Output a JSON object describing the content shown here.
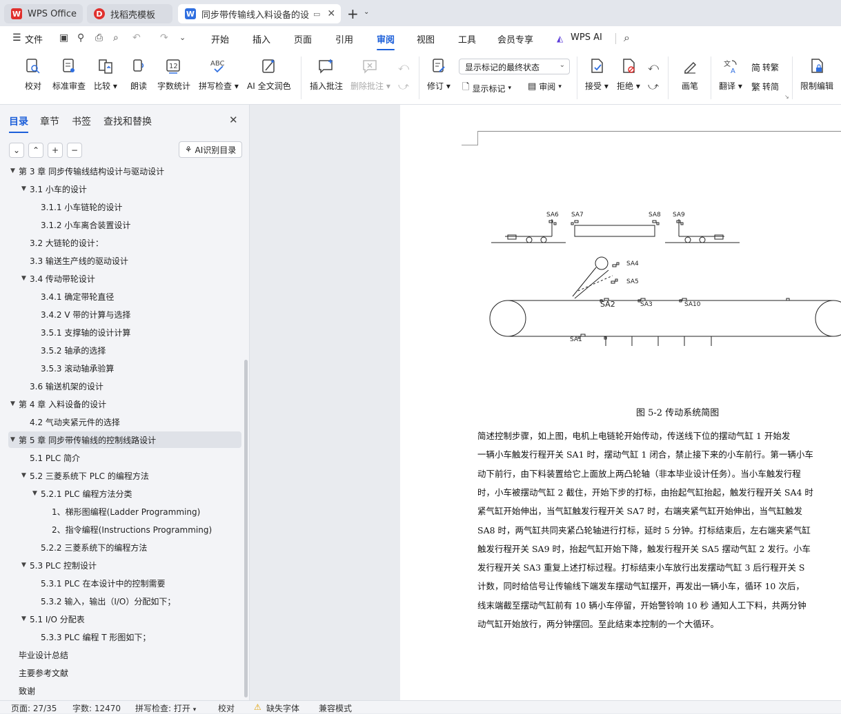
{
  "tabs": [
    {
      "label": "WPS Office",
      "icon": "wps-logo-icon"
    },
    {
      "label": "找稻壳模板",
      "icon": "docer-icon"
    },
    {
      "label": "同步带传输线入料设备的设计",
      "icon": "word-doc-icon"
    }
  ],
  "menu": {
    "file_label": "文件",
    "items": [
      "开始",
      "插入",
      "页面",
      "引用",
      "审阅",
      "视图",
      "工具",
      "会员专享",
      "WPS AI"
    ],
    "active": "审阅"
  },
  "ribbon": {
    "proofread": "校对",
    "standard_review": "标准审查",
    "compare": "比较",
    "read_aloud": "朗读",
    "word_count": "字数统计",
    "spell_check": "拼写检查",
    "ai_polish": "AI 全文润色",
    "insert_comment": "插入批注",
    "delete_comment": "删除批注",
    "track_changes": "修订",
    "display_mode": "显示标记的最终状态",
    "show_markup": "显示标记",
    "reviewing": "审阅",
    "accept": "接受",
    "reject": "拒绝",
    "pen": "画笔",
    "translate": "翻译",
    "to_traditional": "转繁",
    "to_simplified": "转简",
    "restrict_edit": "限制编辑"
  },
  "nav": {
    "tabs": [
      "目录",
      "章节",
      "书签",
      "查找和替换"
    ],
    "ai_toc_label": "AI识别目录",
    "items": [
      {
        "text": "第 3 章 同步传输线结构设计与驱动设计",
        "level": 1,
        "arrow": "down"
      },
      {
        "text": "3.1 小车的设计",
        "level": 2,
        "arrow": "down"
      },
      {
        "text": "3.1.1 小车链轮的设计",
        "level": 3,
        "arrow": ""
      },
      {
        "text": "3.1.2 小车离合装置设计",
        "level": 3,
        "arrow": ""
      },
      {
        "text": "3.2 大链轮的设计：",
        "level": 2,
        "arrow": ""
      },
      {
        "text": "3.3    输送生产线的驱动设计",
        "level": 2,
        "arrow": ""
      },
      {
        "text": "3.4  传动带轮设计",
        "level": 2,
        "arrow": "down"
      },
      {
        "text": "3.4.1 确定带轮直径",
        "level": 3,
        "arrow": ""
      },
      {
        "text": "3.4.2    V 带的计算与选择",
        "level": 3,
        "arrow": ""
      },
      {
        "text": "3.5.1    支撑轴的设计计算",
        "level": 3,
        "arrow": ""
      },
      {
        "text": "3.5.2 轴承的选择",
        "level": 3,
        "arrow": ""
      },
      {
        "text": "3.5.3 滚动轴承验算",
        "level": 3,
        "arrow": ""
      },
      {
        "text": "3.6 输送机架的设计",
        "level": 2,
        "arrow": ""
      },
      {
        "text": "第 4 章    入料设备的设计",
        "level": 1,
        "arrow": "down"
      },
      {
        "text": "4.2 气动夹紧元件的选择",
        "level": 2,
        "arrow": ""
      },
      {
        "text": "第 5 章    同步带传输线的控制线路设计",
        "level": 1,
        "arrow": "down",
        "selected": true
      },
      {
        "text": "5.1 PLC 简介",
        "level": 2,
        "arrow": ""
      },
      {
        "text": "5.2 三菱系统下 PLC 的编程方法",
        "level": 2,
        "arrow": "down"
      },
      {
        "text": "5.2.1 PLC 编程方法分类",
        "level": 3,
        "arrow": "down"
      },
      {
        "text": "1、梯形图编程(Ladder Programming)",
        "level": 4,
        "arrow": ""
      },
      {
        "text": "2、指令编程(Instructions Programming)",
        "level": 4,
        "arrow": ""
      },
      {
        "text": "5.2.2  三菱系统下的编程方法",
        "level": 3,
        "arrow": ""
      },
      {
        "text": "5.3 PLC 控制设计",
        "level": 2,
        "arrow": "down"
      },
      {
        "text": "5.3.1    PLC 在本设计中的控制需要",
        "level": 3,
        "arrow": ""
      },
      {
        "text": "5.3.2 输入，输出（I/O）分配如下；",
        "level": 3,
        "arrow": ""
      },
      {
        "text": "5.1    I/O 分配表",
        "level": 2,
        "arrow": "down"
      },
      {
        "text": "5.3.3 PLC 编程 T 形图如下；",
        "level": 3,
        "arrow": ""
      },
      {
        "text": "毕业设计总结",
        "level": 1,
        "arrow": ""
      },
      {
        "text": "主要参考文献",
        "level": 1,
        "arrow": ""
      },
      {
        "text": "致谢",
        "level": 1,
        "arrow": ""
      }
    ]
  },
  "document": {
    "diagram_labels": {
      "sa1": "SA1",
      "sa2": "SA2",
      "sa3": "SA3",
      "sa4": "SA4",
      "sa5": "SA5",
      "sa6": "SA6",
      "sa7": "SA7",
      "sa8": "SA8",
      "sa9": "SA9",
      "sa10": "SA10"
    },
    "figure_caption": "图 5-2 传动系统简图",
    "paragraph_lines": [
      "    简述控制步骤，如上图，电机上电链轮开始传动，传送线下位的摆动气缸 1 开始发",
      "一辆小车触发行程开关 SA1 时，摆动气缸 1 闭合，禁止接下来的小车前行。第一辆小车",
      "动下前行，由下料装置给它上面放上两凸轮轴（非本毕业设计任务）。当小车触发行程",
      "时，小车被摆动气缸 2 截住，开始下步的打标，由抬起气缸抬起，触发行程开关 SA4 时",
      "紧气缸开始伸出，当气缸触发行程开关 SA7 时，右端夹紧气缸开始伸出，当气缸触发",
      "SA8 时，两气缸共同夹紧凸轮轴进行打标，延时 5 分钟。打标结束后，左右端夹紧气缸",
      "触发行程开关 SA9 时，抬起气缸开始下降，触发行程开关 SA5 摆动气缸 2 发行。小车",
      "发行程开关 SA3  重复上述打标过程。打标结束小车放行出发摆动气缸 3 后行程开关 S",
      "计数，同时给信号让传输线下端发车摆动气缸摆开，再发出一辆小车，循环 10 次后，",
      "线末端截至摆动气缸前有 10 辆小车停留，开始警铃响 10 秒    通知人工下料，共两分钟",
      "动气缸开始放行，两分钟摆回。至此结束本控制的一个大循环。"
    ]
  },
  "status": {
    "page": "页面: 27/35",
    "words": "字数: 12470",
    "spell": "拼写检查: 打开",
    "proof": "校对",
    "missing_font": "缺失字体",
    "compat": "兼容模式"
  },
  "colors": {
    "accent": "#1c5fd9",
    "wps_red": "#e0302d"
  }
}
